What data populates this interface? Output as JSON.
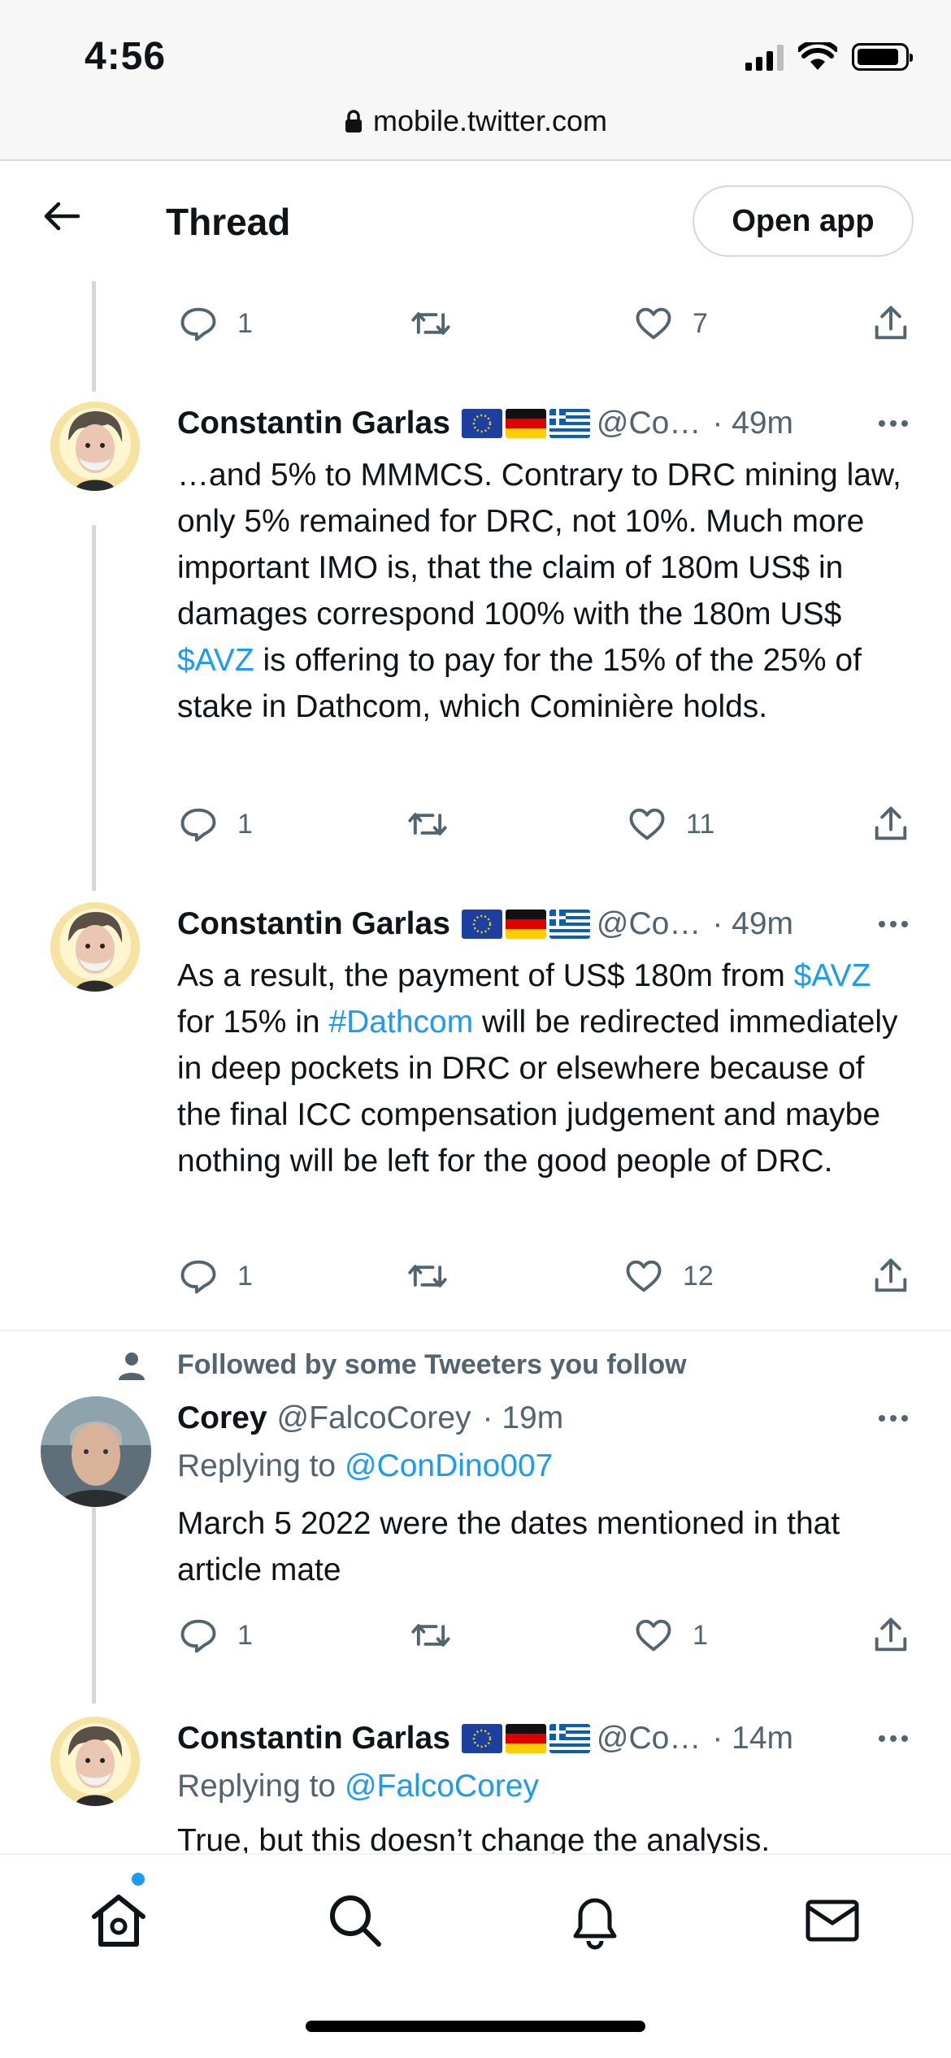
{
  "status_bar": {
    "time": "4:56"
  },
  "browser": {
    "url": "mobile.twitter.com"
  },
  "header": {
    "title": "Thread",
    "open_app_label": "Open app"
  },
  "colors": {
    "accent": "#1d9bf0",
    "muted": "#536471",
    "text": "#0f1419"
  },
  "top_actions": {
    "replies": "1",
    "likes": "7"
  },
  "tweets": [
    {
      "name": "Constantin Garlas",
      "handle": "@Co…",
      "time": "· 49m",
      "text_parts": [
        "…and 5% to MMMCS. Contrary to DRC mining law, only 5% remained for DRC, not 10%. Much more important IMO is, that the claim of 180m US$ in damages correspond 100% with the 180m US$ ",
        "$AVZ",
        " is offering to pay for the 15% of the 25% of stake in Dathcom, which Cominière holds."
      ],
      "replies": "1",
      "likes": "11"
    },
    {
      "name": "Constantin Garlas",
      "handle": "@Co…",
      "time": "· 49m",
      "text_parts": [
        "As a result, the payment of US$ 180m from ",
        "$AVZ",
        " for 15% in ",
        "#Dathcom",
        " will be redirected immediately in deep pockets in DRC or elsewhere because of the final ICC compensation judgement and maybe nothing will be left for the good people of DRC."
      ],
      "replies": "1",
      "likes": "12"
    },
    {
      "social_context": "Followed by some Tweeters you follow",
      "name": "Corey",
      "handle": "@FalcoCorey",
      "time": "· 19m",
      "replying_label": "Replying to ",
      "replying_to": "@ConDino007",
      "text": "March 5 2022 were the dates mentioned in that article mate",
      "replies": "1",
      "likes": "1"
    },
    {
      "name": "Constantin Garlas",
      "handle": "@Co…",
      "time": "· 14m",
      "replying_label": "Replying to ",
      "replying_to": "@FalcoCorey",
      "text": "True, but this doesn’t change the analysis."
    }
  ],
  "nav": {
    "icons": [
      "home-icon",
      "search-icon",
      "notifications-icon",
      "messages-icon"
    ]
  }
}
